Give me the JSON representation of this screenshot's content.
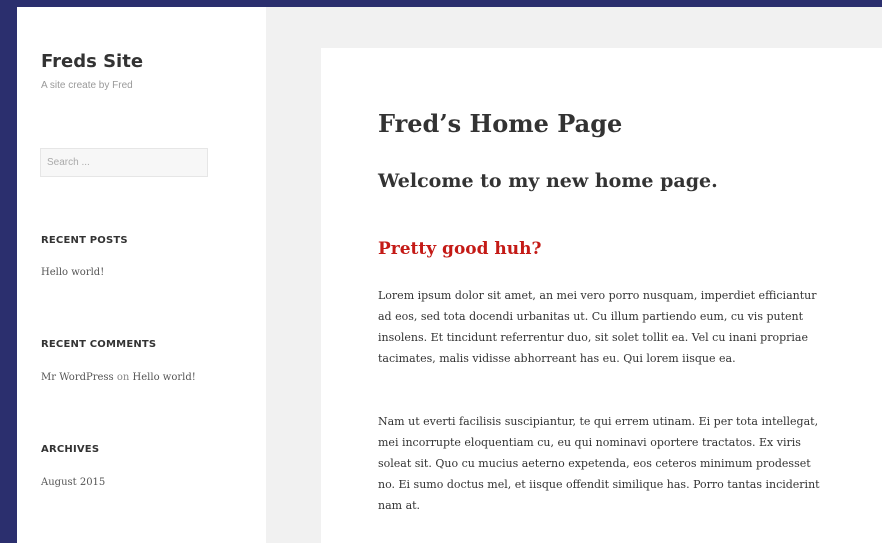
{
  "sidebar": {
    "site_title": "Freds Site",
    "site_description": "A site create by Fred",
    "search_placeholder": "Search ...",
    "recent_posts": {
      "title": "RECENT POSTS",
      "items": [
        "Hello world!"
      ]
    },
    "recent_comments": {
      "title": "RECENT COMMENTS",
      "items": [
        {
          "author": "Mr WordPress",
          "connector": "on",
          "post": "Hello world!"
        }
      ]
    },
    "archives": {
      "title": "ARCHIVES",
      "items": [
        "August 2015"
      ]
    }
  },
  "main": {
    "page_title": "Fred’s Home Page",
    "heading": "Welcome to my new home page.",
    "subheading": "Pretty good huh?",
    "paragraphs": [
      "Lorem ipsum dolor sit amet, an mei vero porro nusquam, imperdiet efficiantur ad eos, sed tota docendi urbanitas ut. Cu illum partiendo eum, cu vis putent insolens. Et tincidunt referrentur duo, sit solet tollit ea. Vel cu inani propriae tacimates, malis vidisse abhorreant has eu. Qui lorem iisque ea.",
      "Nam ut everti facilisis suscipiantur, te qui errem utinam. Ei per tota intellegat, mei incorrupte eloquentiam cu, eu qui nominavi oportere tractatos. Ex viris soleat sit. Quo cu mucius aeterno expetenda, eos ceteros minimum prodesset no. Ei sumo doctus mel, et iisque offendit similique has. Porro tantas inciderint nam at."
    ]
  },
  "colors": {
    "background": "#2b2f6e",
    "page": "#f1f1f1",
    "accent_heading": "#c41a16"
  }
}
